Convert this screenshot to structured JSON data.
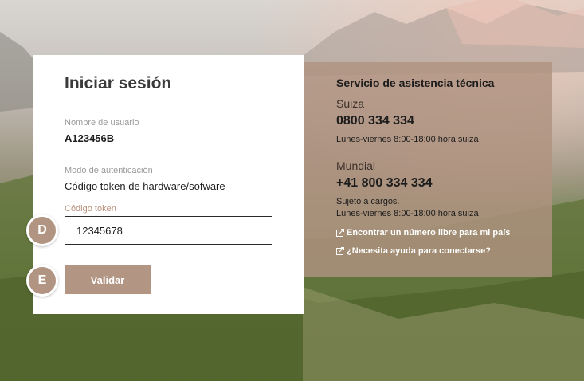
{
  "login": {
    "title": "Iniciar sesión",
    "username_label": "Nombre de usuario",
    "username_value": "A123456B",
    "auth_mode_label": "Modo de autenticación",
    "auth_mode_value": "Código token de hardware/sofware",
    "token_label": "Código token",
    "token_value": "12345678",
    "validate_label": "Validar"
  },
  "markers": {
    "d": "D",
    "e": "E"
  },
  "support": {
    "title": "Servicio de asistencia técnica",
    "swiss_region": "Suiza",
    "swiss_phone": "0800 334 334",
    "swiss_hours": "Lunes-viernes 8:00-18:00 hora suiza",
    "world_region": "Mundial",
    "world_phone": "+41 800 334 334",
    "world_note": "Sujeto a cargos.",
    "world_hours": "Lunes-viernes 8:00-18:00 hora suiza",
    "link_free_number": "Encontrar un número libre para mi país",
    "link_help": "¿Necesita ayuda para conectarse?"
  },
  "icons": {
    "external_link": "external-link-icon"
  },
  "colors": {
    "accent": "#b39584",
    "panel": "#b09280",
    "token_label": "#b88f79"
  }
}
